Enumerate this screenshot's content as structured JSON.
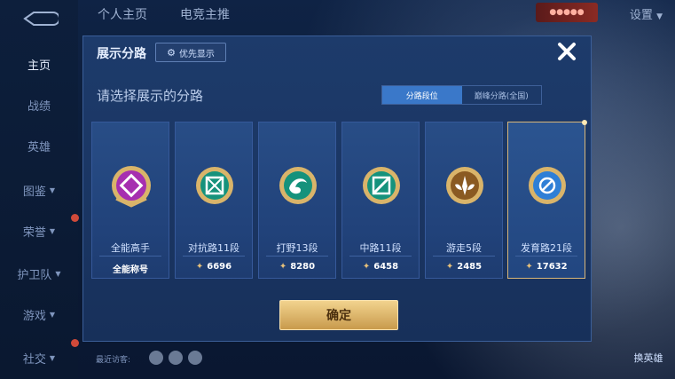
{
  "topbar": {
    "tab_home": "个人主页",
    "tab_esports": "电竞主推",
    "settings": "设置"
  },
  "nav": {
    "items": [
      "主页",
      "战绩",
      "英雄",
      "图鉴",
      "荣誉",
      "护卫队",
      "游戏",
      "社交"
    ],
    "active": "主页"
  },
  "dialog": {
    "title": "展示分路",
    "priority_label": "优先显示",
    "subtitle": "请选择展示的分路",
    "seg_left": "分路段位",
    "seg_right": "巅峰分路(全国)",
    "confirm": "确定",
    "cards": [
      {
        "label": "全能高手",
        "score": "全能称号",
        "score_is_text": true,
        "color": "#b03ab8"
      },
      {
        "label": "对抗路11段",
        "score": "6696",
        "color": "#1aa58a"
      },
      {
        "label": "打野13段",
        "score": "8280",
        "color": "#1aa58a"
      },
      {
        "label": "中路11段",
        "score": "6458",
        "color": "#1aa58a"
      },
      {
        "label": "游走5段",
        "score": "2485",
        "color": "#b77a2e"
      },
      {
        "label": "发育路21段",
        "score": "17632",
        "color": "#2f7fd6"
      }
    ],
    "selected_index": 5
  },
  "footer": {
    "visitors": "最近访客:"
  },
  "right_buttons": {
    "btn1": "换英雄"
  }
}
